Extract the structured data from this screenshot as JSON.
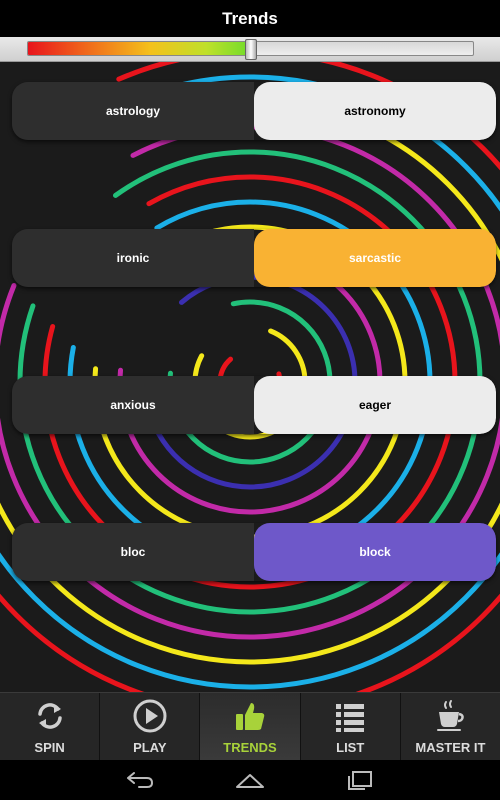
{
  "header": {
    "title": "Trends"
  },
  "slider": {
    "value_fraction": 0.5
  },
  "pairs": [
    {
      "left": "astrology",
      "right": "astronomy",
      "right_color": "#ececec",
      "right_text": "#000000"
    },
    {
      "left": "ironic",
      "right": "sarcastic",
      "right_color": "#f9b233",
      "right_text": "#ffffff"
    },
    {
      "left": "anxious",
      "right": "eager",
      "right_color": "#ececec",
      "right_text": "#000000"
    },
    {
      "left": "bloc",
      "right": "block",
      "right_color": "#6e58c9",
      "right_text": "#ffffff"
    }
  ],
  "tabs": [
    {
      "label": "SPIN",
      "icon": "spin-arrows-icon"
    },
    {
      "label": "PLAY",
      "icon": "play-icon"
    },
    {
      "label": "TRENDS",
      "icon": "thumbs-up-icon",
      "active": true
    },
    {
      "label": "LIST",
      "icon": "list-icon"
    },
    {
      "label": "MASTER IT",
      "icon": "coffee-cup-icon"
    }
  ],
  "colors": {
    "accent": "#a8d23a"
  }
}
